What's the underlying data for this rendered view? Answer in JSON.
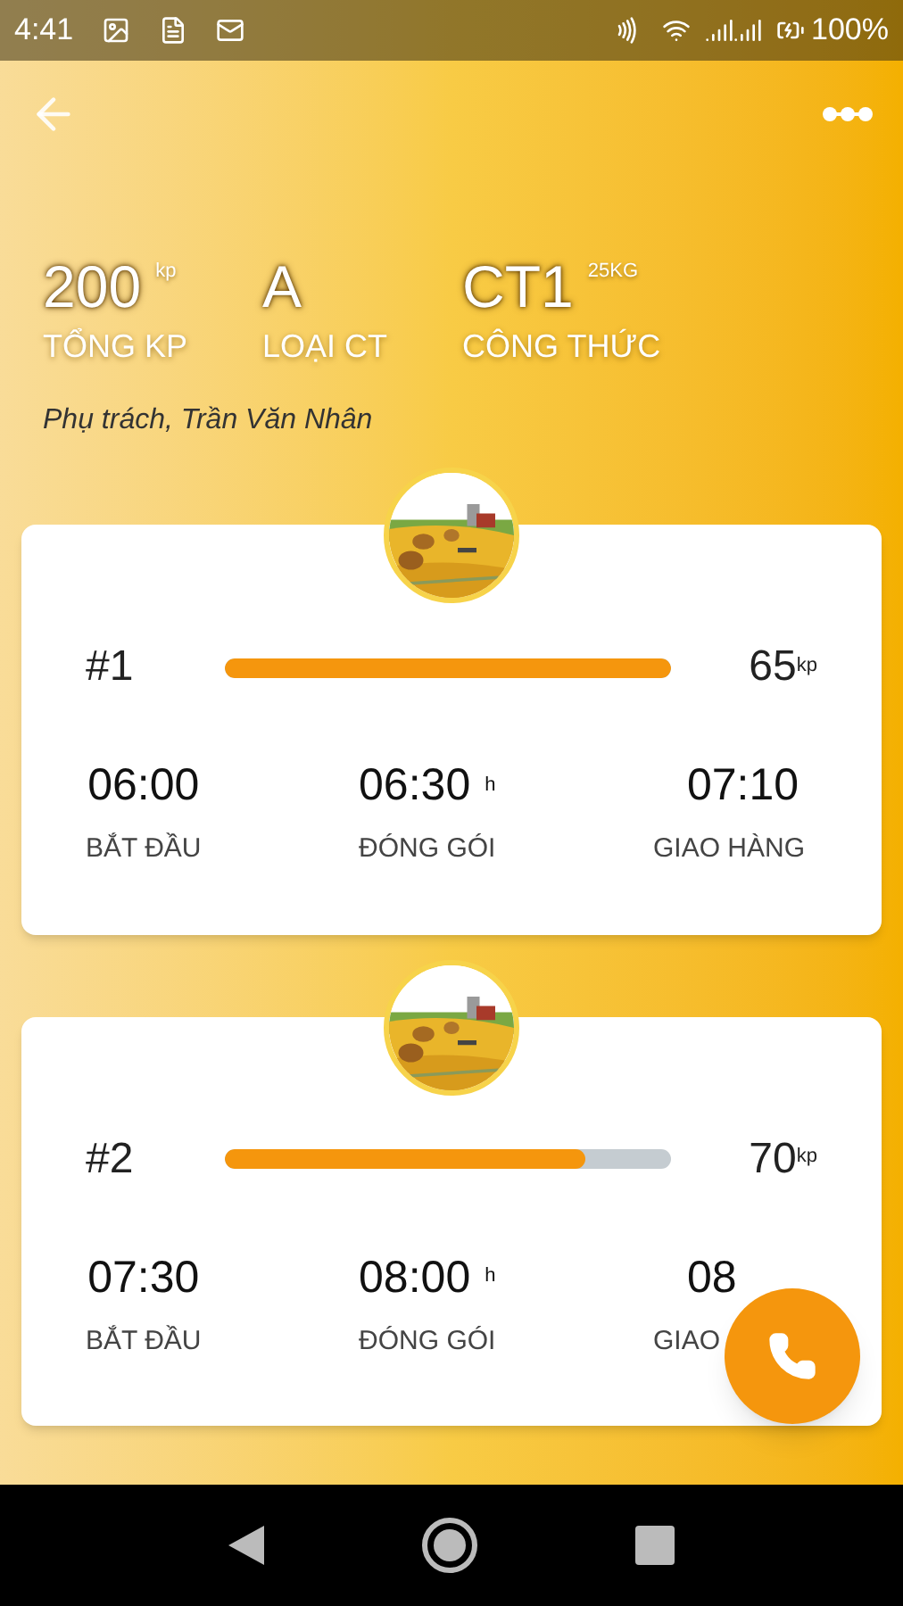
{
  "status_bar": {
    "time": "4:41",
    "battery": "100%"
  },
  "stats": [
    {
      "value": "200",
      "unit": "kp",
      "label": "TỔNG KP"
    },
    {
      "value": "A",
      "label": "LOẠI CT"
    },
    {
      "value": "CT1",
      "unit": "25KG",
      "label": "CÔNG THỨC"
    }
  ],
  "manager": "Phụ trách, Trần Văn Nhân",
  "batches": [
    {
      "number": "#1",
      "level": 1.0,
      "points": "65",
      "points_unit": "kp",
      "times": [
        {
          "time": "06:00",
          "label": "BẮT ĐẦU"
        },
        {
          "time": "06:30",
          "unit": "h",
          "label": "ĐÓNG GÓI"
        },
        {
          "time": "07:10",
          "label": "GIAO HÀNG"
        }
      ]
    },
    {
      "number": "#2",
      "level": 0.81,
      "points": "70",
      "points_unit": "kp",
      "times": [
        {
          "time": "07:30",
          "label": "BẮT ĐẦU"
        },
        {
          "time": "08:00",
          "unit": "h",
          "label": "ĐÓNG GÓI"
        },
        {
          "time": "08",
          "label": "GIAO"
        }
      ]
    }
  ]
}
